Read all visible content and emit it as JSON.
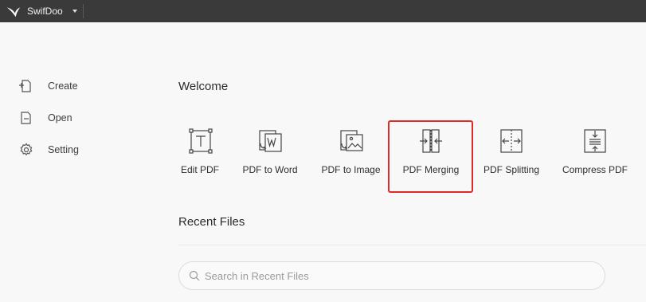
{
  "app": {
    "name": "SwifDoo"
  },
  "sidebar": {
    "items": [
      {
        "label": "Create",
        "icon": "create-file-icon"
      },
      {
        "label": "Open",
        "icon": "open-folder-icon"
      },
      {
        "label": "Setting",
        "icon": "gear-icon"
      }
    ]
  },
  "main": {
    "welcome": "Welcome",
    "tools": [
      {
        "label": "Edit PDF",
        "icon": "edit-text-icon"
      },
      {
        "label": "PDF to Word",
        "icon": "word-convert-icon"
      },
      {
        "label": "PDF to Image",
        "icon": "image-convert-icon"
      },
      {
        "label": "PDF Merging",
        "icon": "merge-icon",
        "highlighted": true
      },
      {
        "label": "PDF Splitting",
        "icon": "split-icon"
      },
      {
        "label": "Compress PDF",
        "icon": "compress-icon"
      }
    ],
    "recent_title": "Recent Files",
    "search": {
      "placeholder": "Search in Recent Files",
      "value": ""
    }
  },
  "colors": {
    "titlebar": "#3a3a3b",
    "highlight": "#e02a27",
    "background": "#f8f8f8"
  }
}
